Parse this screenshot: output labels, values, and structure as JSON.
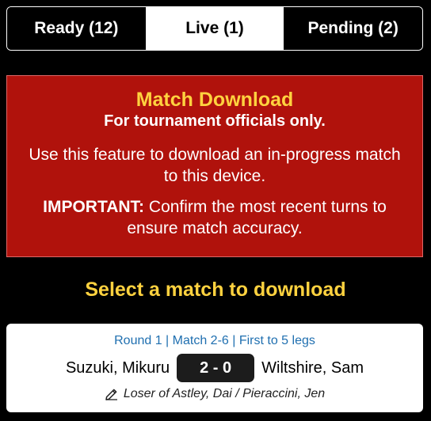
{
  "tabs": [
    {
      "label": "Ready (12)",
      "active": false
    },
    {
      "label": "Live (1)",
      "active": true
    },
    {
      "label": "Pending (2)",
      "active": false
    }
  ],
  "notice": {
    "title": "Match Download",
    "subtitle": "For tournament officials only.",
    "body": "Use this feature to download an in-progress match to this device.",
    "important_label": "IMPORTANT:",
    "important_text": " Confirm the most recent turns to ensure match accuracy."
  },
  "select_heading": "Select a match to download",
  "match": {
    "meta": "Round 1 | Match 2-6 | First to 5 legs",
    "player_left": "Suzuki, Mikuru",
    "score": "2 - 0",
    "player_right": "Wiltshire, Sam",
    "note_icon": "edit-icon",
    "note": "Loser of Astley, Dai / Pieraccini, Jen"
  },
  "colors": {
    "notice_bg": "#b0120c",
    "accent_yellow": "#ffd23f",
    "meta_blue": "#1f6fb0"
  }
}
